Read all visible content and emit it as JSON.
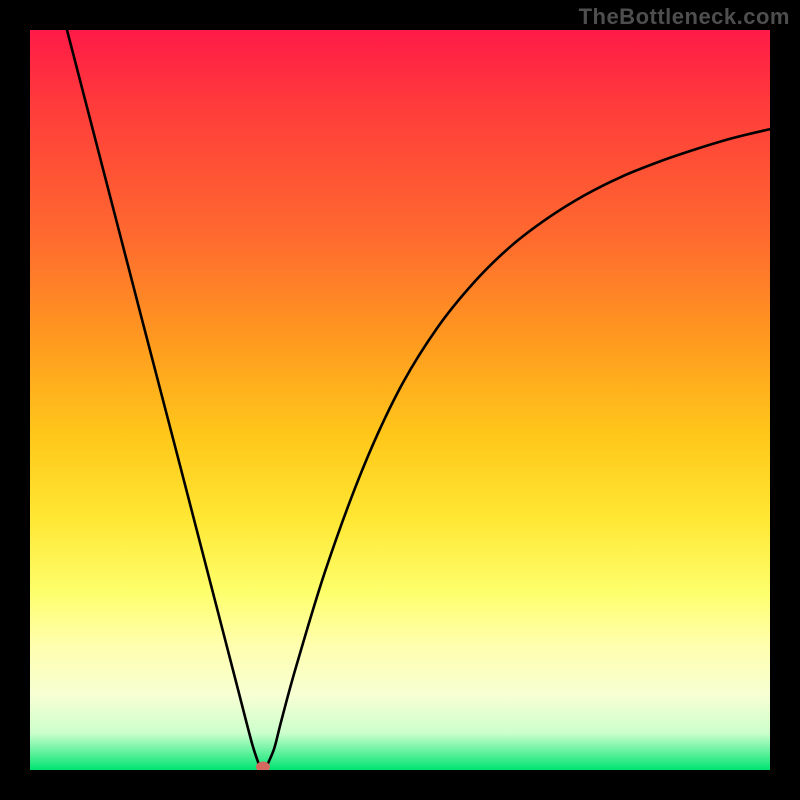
{
  "watermark": "TheBottleneck.com",
  "colors": {
    "frame_bg": "#000000",
    "gradient_top": "#ff1a47",
    "gradient_mid1": "#ff9a1f",
    "gradient_mid2": "#ffe733",
    "gradient_mid3": "#ffffad",
    "gradient_bottom": "#00e472",
    "curve_stroke": "#000000",
    "min_dot": "#d46a5f"
  },
  "chart_data": {
    "type": "line",
    "title": "",
    "xlabel": "",
    "ylabel": "",
    "xlim": [
      0,
      100
    ],
    "ylim": [
      0,
      100
    ],
    "grid": false,
    "legend": false,
    "series": [
      {
        "name": "bottleneck-curve",
        "x": [
          5,
          10,
          15,
          20,
          25,
          28,
          30,
          31,
          31.5,
          32,
          33,
          34,
          36,
          40,
          45,
          50,
          55,
          60,
          65,
          70,
          75,
          80,
          85,
          90,
          95,
          100
        ],
        "values": [
          100,
          80.7,
          61.4,
          42.2,
          22.9,
          11.3,
          3.6,
          0.5,
          0,
          0.5,
          2.9,
          6.8,
          14.1,
          27.2,
          40.8,
          51.6,
          59.7,
          65.9,
          70.8,
          74.6,
          77.7,
          80.2,
          82.2,
          83.9,
          85.4,
          86.6
        ]
      }
    ],
    "minimum_point": {
      "x": 31.5,
      "y": 0
    },
    "minimum_flat_segment": {
      "x_start": 30.8,
      "x_end": 32.2
    }
  }
}
